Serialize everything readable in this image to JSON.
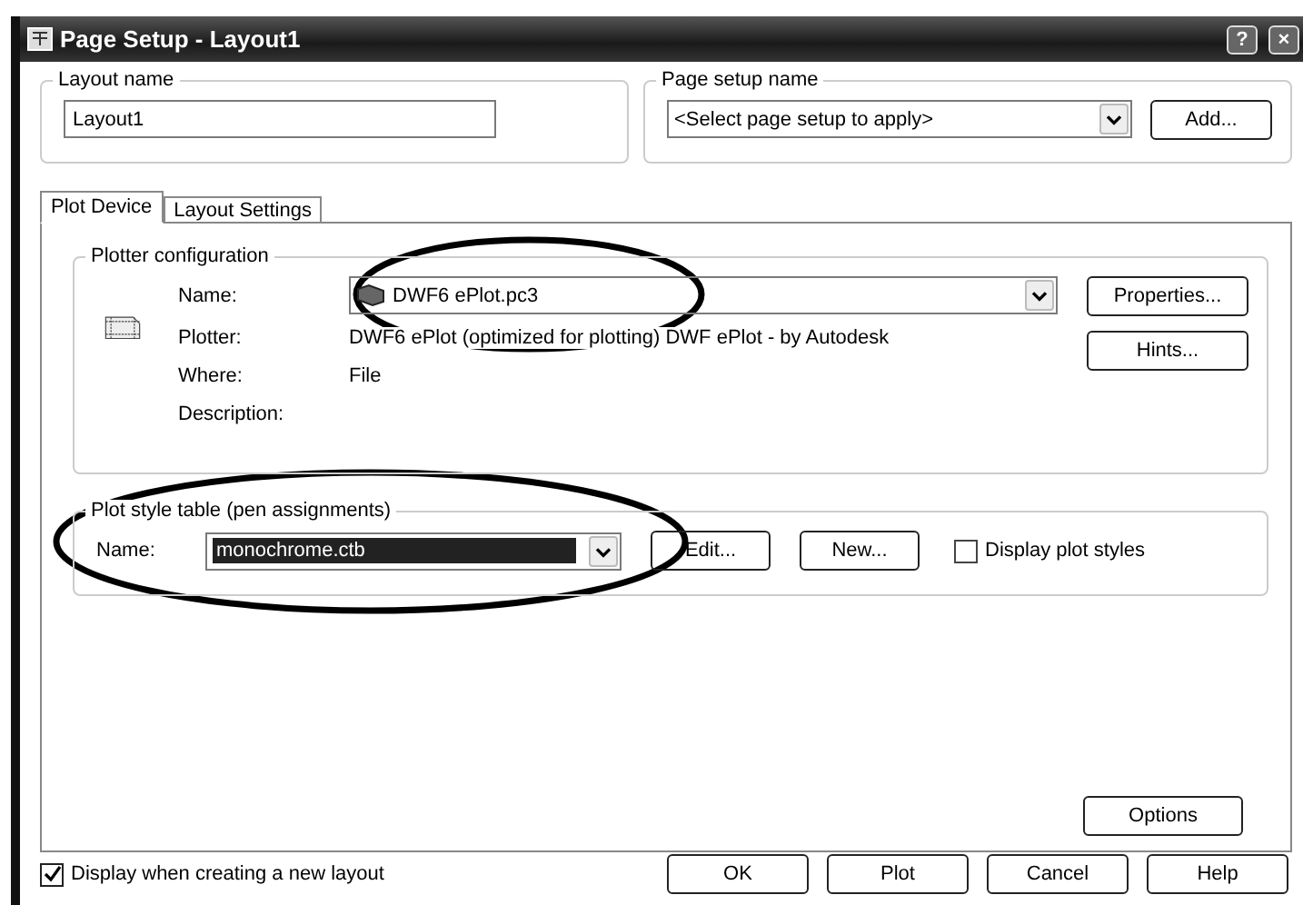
{
  "window": {
    "title": "Page Setup - Layout1",
    "controls": [
      "?",
      "×"
    ]
  },
  "layout_name": {
    "label": "Layout name",
    "value": "Layout1"
  },
  "page_setup_name": {
    "label": "Page setup name",
    "value": "<Select page setup to apply>",
    "button": "Add..."
  },
  "tabs": [
    {
      "label": "Plot Device",
      "selected": true
    },
    {
      "label": "Layout Settings",
      "selected": false
    }
  ],
  "plotter_configuration": {
    "label": "Plotter configuration",
    "name": {
      "label": "Name:",
      "value": "DWF6 ePlot.pc3"
    },
    "details": [
      {
        "label": "Plotter:",
        "value": "DWF6 ePlot (optimized for plotting) DWF ePlot - by Autodesk"
      },
      {
        "label": "Where:",
        "value": "File"
      },
      {
        "label": "Description:"
      }
    ],
    "buttons": [
      "Properties...",
      "Hints..."
    ]
  },
  "plot_style_table": {
    "label": "Plot style table (pen assignments)",
    "name_label": "Name:",
    "value": "monochrome.ctb",
    "buttons": [
      "Edit...",
      "New..."
    ],
    "display_plot_styles": {
      "label": "Display plot styles",
      "checked": false
    }
  },
  "options_button": "Options",
  "display_when_creating": {
    "label": "Display when creating a new layout",
    "checked": true
  },
  "buttons": [
    "OK",
    "Plot",
    "Cancel",
    "Help"
  ]
}
